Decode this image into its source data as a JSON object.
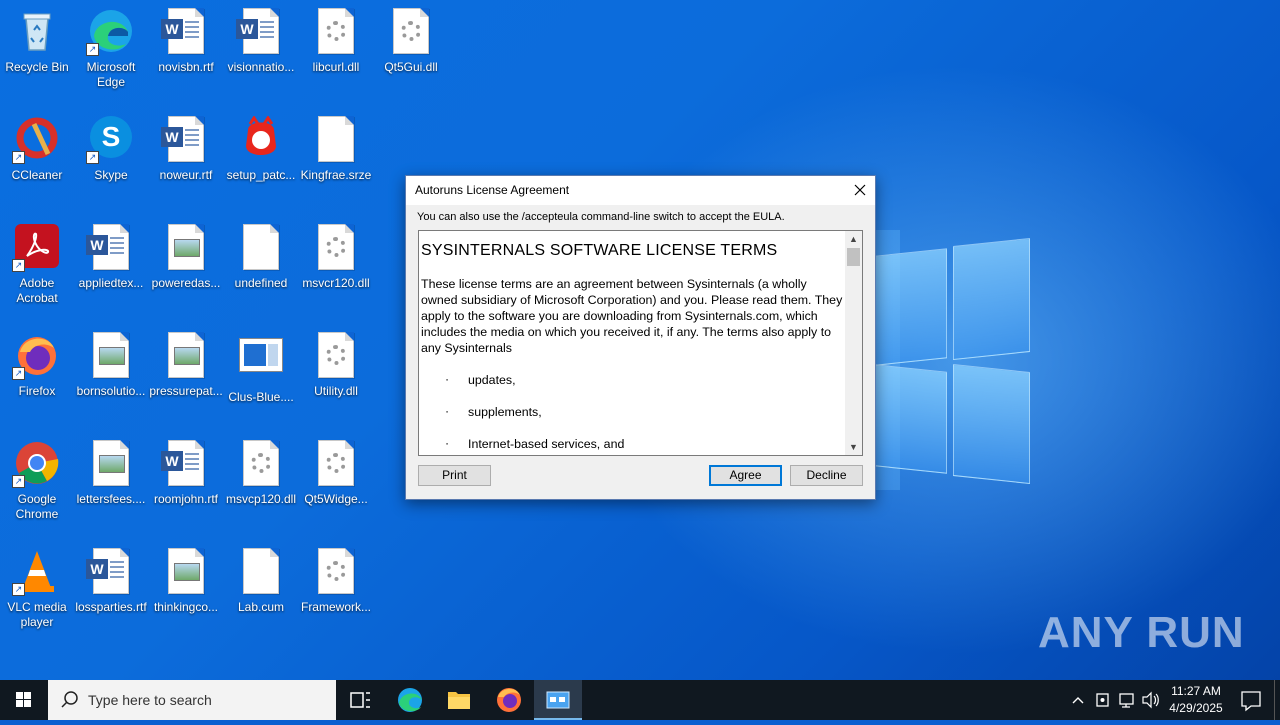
{
  "desktop": {
    "icons": [
      {
        "label": "Recycle Bin"
      },
      {
        "label": "Microsoft Edge"
      },
      {
        "label": "novisbn.rtf"
      },
      {
        "label": "visionnatio..."
      },
      {
        "label": "libcurl.dll"
      },
      {
        "label": "Qt5Gui.dll"
      },
      {
        "label": "CCleaner"
      },
      {
        "label": "Skype"
      },
      {
        "label": "noweur.rtf"
      },
      {
        "label": "setup_patc..."
      },
      {
        "label": "Kingfrae.srze"
      },
      {
        "label": "Adobe Acrobat"
      },
      {
        "label": "appliedtex..."
      },
      {
        "label": "poweredas..."
      },
      {
        "label": "undefined"
      },
      {
        "label": "msvcr120.dll"
      },
      {
        "label": "Firefox"
      },
      {
        "label": "bornsolutio..."
      },
      {
        "label": "pressurepat..."
      },
      {
        "label": "Clus-Blue...."
      },
      {
        "label": "Utility.dll"
      },
      {
        "label": "Google Chrome"
      },
      {
        "label": "lettersfees...."
      },
      {
        "label": "roomjohn.rtf"
      },
      {
        "label": "msvcp120.dll"
      },
      {
        "label": "Qt5Widge..."
      },
      {
        "label": "VLC media player"
      },
      {
        "label": "lossparties.rtf"
      },
      {
        "label": "thinkingco..."
      },
      {
        "label": "Lab.cum"
      },
      {
        "label": "Framework..."
      }
    ]
  },
  "dialog": {
    "title": "Autoruns License Agreement",
    "hint": "You can also use the /accepteula command-line switch to accept the EULA.",
    "license_heading": "SYSINTERNALS SOFTWARE LICENSE TERMS",
    "license_paragraph": "These license terms are an agreement between Sysinternals (a wholly owned subsidiary of Microsoft Corporation) and you.  Please read them. They apply to the software you are downloading from Sysinternals.com, which includes the media on which you received it, if any.  The terms also apply to any Sysinternals",
    "bullets": [
      "updates,",
      "supplements,",
      "Internet-based services, and"
    ],
    "print_label": "Print",
    "agree_label": "Agree",
    "decline_label": "Decline"
  },
  "watermark": "ANY RUN",
  "taskbar": {
    "search_placeholder": "Type here to search",
    "time": "11:27 AM",
    "date": "4/29/2025"
  }
}
